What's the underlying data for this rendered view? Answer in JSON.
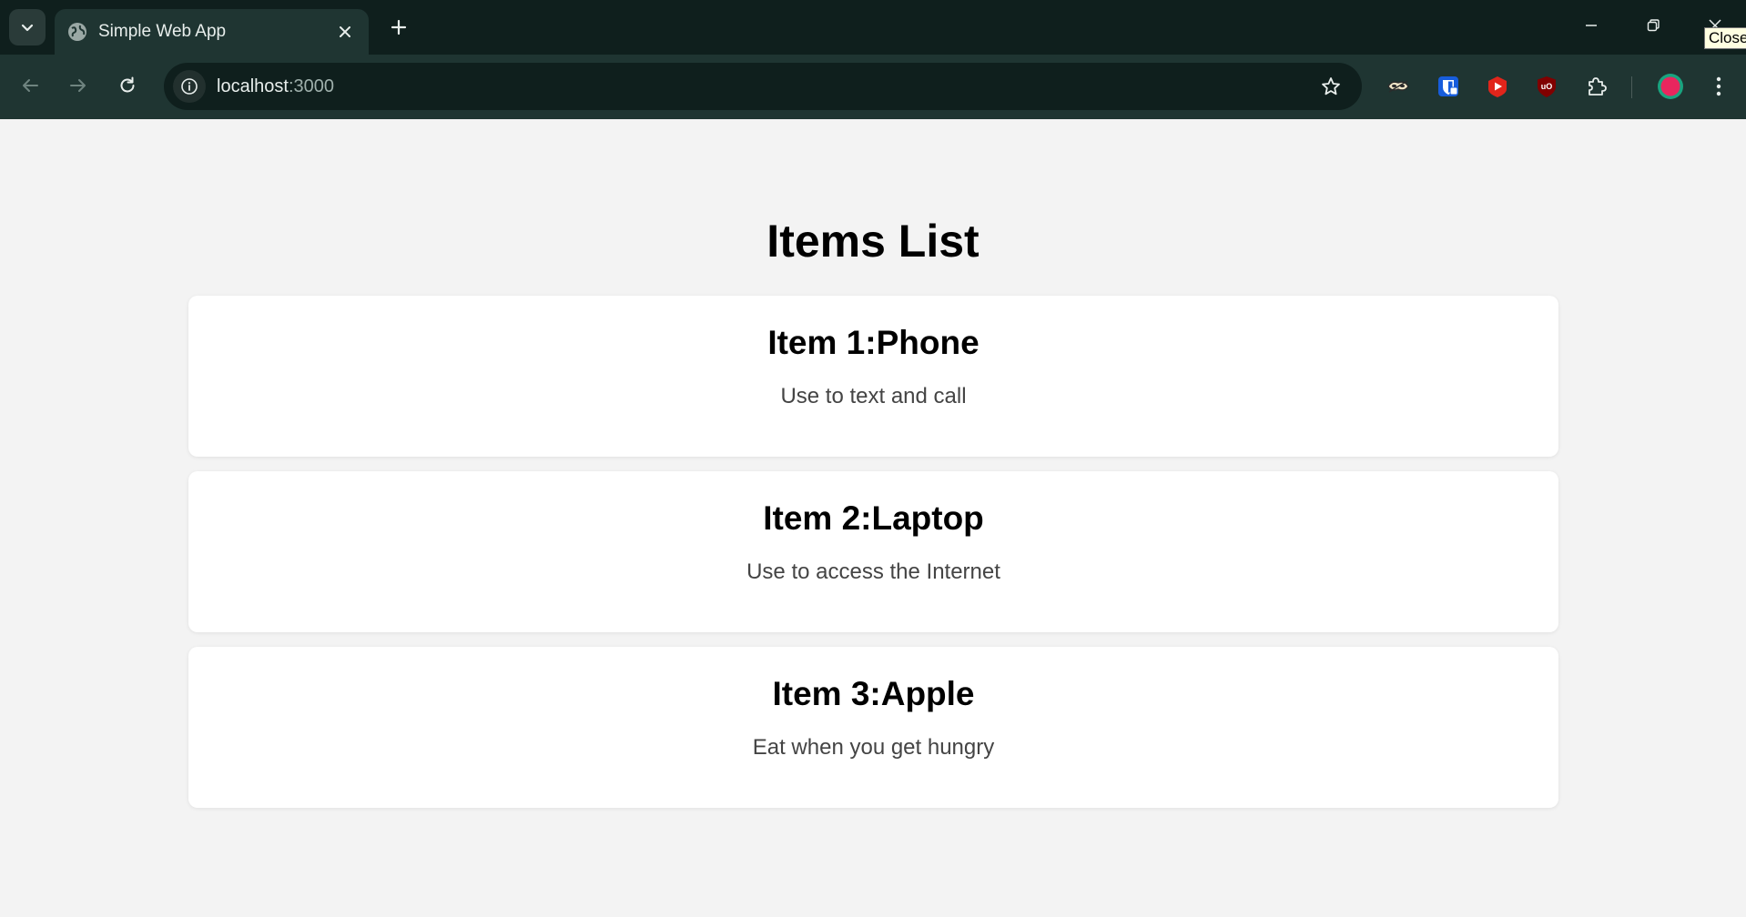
{
  "browser": {
    "tab": {
      "title": "Simple Web App"
    },
    "address_bar": {
      "url_host": "localhost",
      "url_port": ":3000"
    },
    "tooltip": "Close",
    "accent_colors": {
      "chrome_dark": "#0f1f1d",
      "chrome_toolbar": "#1f3532"
    }
  },
  "page": {
    "title": "Items List",
    "items": [
      {
        "title": "Item 1:Phone",
        "description": "Use to text and call"
      },
      {
        "title": "Item 2:Laptop",
        "description": "Use to access the Internet"
      },
      {
        "title": "Item 3:Apple",
        "description": "Eat when you get hungry"
      }
    ]
  },
  "icons": {
    "tab_search": "chevron-down-icon",
    "favicon": "globe-icon",
    "tab_close": "close-icon",
    "new_tab": "plus-icon",
    "back": "arrow-left-icon",
    "forward": "arrow-right-icon",
    "reload": "reload-icon",
    "site_info": "info-icon",
    "bookmark": "star-icon",
    "extensions": [
      "mask-extension-icon",
      "bitwarden-icon",
      "youtube-icon",
      "ublock-icon",
      "puzzle-icon"
    ],
    "profile": "profile-avatar-icon",
    "menu": "kebab-menu-icon"
  }
}
